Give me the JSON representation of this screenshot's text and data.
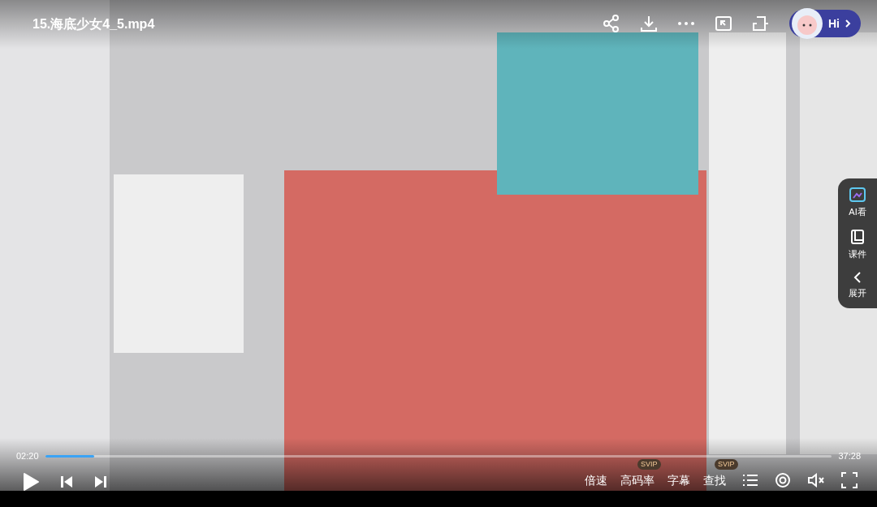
{
  "title": "15.海底少女4_5.mp4",
  "assistant": {
    "label": "Hi"
  },
  "side_panel": [
    {
      "kind": "ai",
      "label": "AI看"
    },
    {
      "kind": "courseware",
      "label": "课件"
    },
    {
      "kind": "expand",
      "label": "展开"
    }
  ],
  "player": {
    "elapsed": "02:20",
    "duration": "37:28",
    "level": 0.062,
    "playing": false,
    "options": [
      {
        "label": "倍速"
      },
      {
        "label": "高码率",
        "badge": "SVIP"
      },
      {
        "label": "字幕"
      },
      {
        "label": "查找",
        "badge": "SVIP"
      }
    ]
  }
}
